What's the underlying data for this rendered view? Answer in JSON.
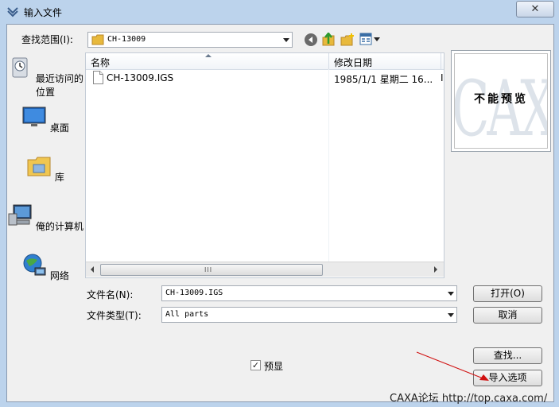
{
  "window": {
    "title": "输入文件",
    "close_glyph": "✕"
  },
  "toolbar": {
    "lookin_label": "查找范围(I):",
    "lookin_value": "CH-13009"
  },
  "places": [
    {
      "label": "最近访问的位置",
      "icon": "recent-places-icon"
    },
    {
      "label": "桌面",
      "icon": "desktop-icon"
    },
    {
      "label": "库",
      "icon": "libraries-icon"
    },
    {
      "label": "俺的计算机",
      "icon": "computer-icon"
    },
    {
      "label": "网络",
      "icon": "network-icon"
    }
  ],
  "filelist": {
    "columns": [
      "名称",
      "修改日期"
    ],
    "rows": [
      {
        "name": "CH-13009.IGS",
        "date": "1985/1/1 星期二 16...",
        "extra": "I"
      }
    ],
    "scroll_grip": "III"
  },
  "preview": {
    "watermark": "CAXA",
    "message": "不能预览"
  },
  "form": {
    "filename_label": "文件名(N):",
    "filename_value": "CH-13009.IGS",
    "filetype_label": "文件类型(T):",
    "filetype_value": "All parts"
  },
  "buttons": {
    "open": "打开(O)",
    "cancel": "取消",
    "find": "查找...",
    "import_options": "导入选项"
  },
  "options": {
    "preview_label": "预显",
    "preview_checked": true,
    "check_glyph": "✓"
  },
  "watermark_text": "CAXA论坛 http://top.caxa.com/"
}
